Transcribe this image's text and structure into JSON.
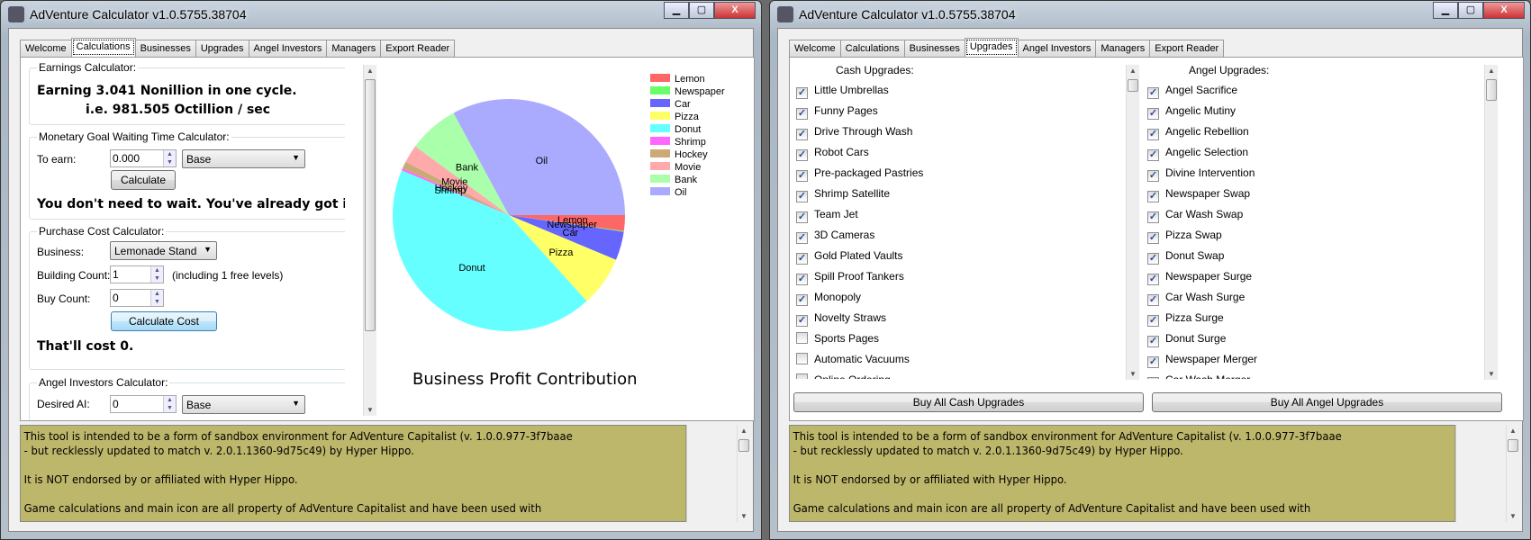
{
  "window_title": "AdVenture Calculator v1.0.5755.38704",
  "controls": {
    "minimize": "▁",
    "maximize": "▢",
    "close": "X"
  },
  "tabs": [
    "Welcome",
    "Calculations",
    "Businesses",
    "Upgrades",
    "Angel Investors",
    "Managers",
    "Export Reader"
  ],
  "left": {
    "selected_tab": "Calculations",
    "earnings": {
      "title": "Earnings Calculator:",
      "line1": "Earning 3.041 Nonillion in one cycle.",
      "line2": "i.e. 981.505 Octillion / sec"
    },
    "monetary": {
      "title": "Monetary Goal Waiting Time Calculator:",
      "to_earn_label": "To earn:",
      "to_earn_value": "0.000",
      "unit": "Base",
      "button": "Calculate",
      "result": "You don't need to wait. You've already got it :)"
    },
    "purchase": {
      "title": "Purchase Cost Calculator:",
      "business_label": "Business:",
      "business_value": "Lemonade Stand",
      "building_label": "Building Count:",
      "building_value": "1",
      "building_note": "(including 1 free levels)",
      "buy_label": "Buy Count:",
      "buy_value": "0",
      "button": "Calculate Cost",
      "result": "That'll cost 0."
    },
    "angel": {
      "title": "Angel Investors Calculator:",
      "desired_label": "Desired AI:",
      "desired_value": "0",
      "unit": "Base"
    }
  },
  "chart_data": {
    "type": "pie",
    "title": "Business Profit Contribution",
    "legend_position": "top-right",
    "categories": [
      "Lemon",
      "Newspaper",
      "Car",
      "Pizza",
      "Donut",
      "Shrimp",
      "Hockey",
      "Movie",
      "Bank",
      "Oil"
    ],
    "values": [
      2.2,
      0.1,
      4.0,
      7.0,
      43.0,
      0.3,
      1.0,
      2.5,
      7.0,
      32.9
    ],
    "colors": [
      "#ff6666",
      "#66ff66",
      "#6666ff",
      "#ffff66",
      "#66ffff",
      "#ff66ff",
      "#ccaa77",
      "#ffaaaa",
      "#aaffaa",
      "#aaaaff"
    ]
  },
  "right": {
    "selected_tab": "Upgrades",
    "cash_title": "Cash Upgrades:",
    "angel_title": "Angel Upgrades:",
    "cash_upgrades": [
      {
        "label": "Little Umbrellas",
        "checked": true
      },
      {
        "label": "Funny Pages",
        "checked": true
      },
      {
        "label": "Drive Through Wash",
        "checked": true
      },
      {
        "label": "Robot Cars",
        "checked": true
      },
      {
        "label": "Pre-packaged Pastries",
        "checked": true
      },
      {
        "label": "Shrimp Satellite",
        "checked": true
      },
      {
        "label": "Team Jet",
        "checked": true
      },
      {
        "label": "3D Cameras",
        "checked": true
      },
      {
        "label": "Gold Plated Vaults",
        "checked": true
      },
      {
        "label": "Spill Proof Tankers",
        "checked": true
      },
      {
        "label": "Monopoly",
        "checked": true
      },
      {
        "label": "Novelty Straws",
        "checked": true
      },
      {
        "label": "Sports Pages",
        "checked": false
      },
      {
        "label": "Automatic Vacuums",
        "checked": false
      },
      {
        "label": "Online Ordering",
        "checked": false
      }
    ],
    "angel_upgrades": [
      {
        "label": "Angel Sacrifice",
        "checked": true
      },
      {
        "label": "Angelic Mutiny",
        "checked": true
      },
      {
        "label": "Angelic Rebellion",
        "checked": true
      },
      {
        "label": "Angelic Selection",
        "checked": true
      },
      {
        "label": "Divine Intervention",
        "checked": true
      },
      {
        "label": "Newspaper Swap",
        "checked": true
      },
      {
        "label": "Car Wash Swap",
        "checked": true
      },
      {
        "label": "Pizza Swap",
        "checked": true
      },
      {
        "label": "Donut Swap",
        "checked": true
      },
      {
        "label": "Newspaper Surge",
        "checked": true
      },
      {
        "label": "Car Wash Surge",
        "checked": true
      },
      {
        "label": "Pizza Surge",
        "checked": true
      },
      {
        "label": "Donut Surge",
        "checked": true
      },
      {
        "label": "Newspaper Merger",
        "checked": true
      },
      {
        "label": "Car Wash Merger",
        "checked": true
      }
    ],
    "buy_cash": "Buy All Cash Upgrades",
    "buy_angel": "Buy All Angel Upgrades"
  },
  "info": {
    "p1": "This tool is intended to be a form of sandbox environment for AdVenture Capitalist (v. 1.0.0.977-3f7baae",
    "p1b": "- but recklessly updated to match v. 2.0.1.1360-9d75c49) by Hyper Hippo.",
    "p2": "It is NOT endorsed by or affiliated with Hyper Hippo.",
    "p3": "Game calculations and main icon are all property of AdVenture Capitalist and have been used with"
  },
  "colors": {
    "info_bg": "#bdb76b"
  }
}
